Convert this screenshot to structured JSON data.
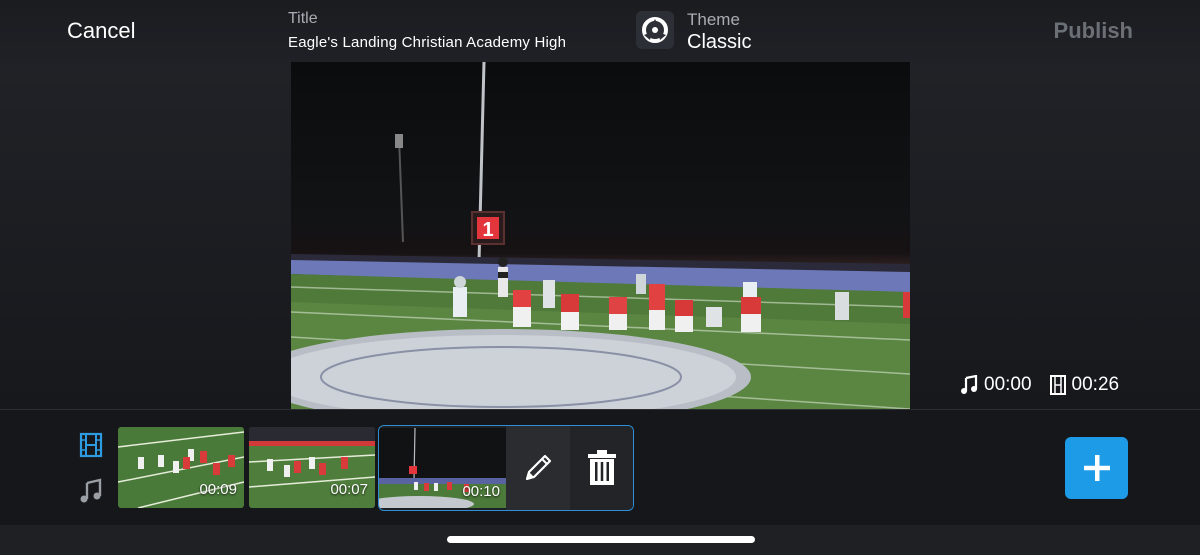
{
  "header": {
    "cancel_label": "Cancel",
    "title_label": "Title",
    "title_value": "Eagle's Landing Christian Academy High",
    "theme_label": "Theme",
    "theme_value": "Classic",
    "publish_label": "Publish"
  },
  "preview": {
    "scoreboard_digit": "1",
    "music_time": "00:00",
    "video_time": "00:26"
  },
  "timeline": {
    "tracks": [
      "film-icon",
      "music-note-icon"
    ],
    "clips": [
      {
        "duration": "00:09"
      },
      {
        "duration": "00:07"
      },
      {
        "duration": "00:10",
        "selected": true
      }
    ],
    "actions": [
      "pencil-icon",
      "trash-icon"
    ],
    "add_icon": "plus-icon"
  },
  "colors": {
    "accent": "#1e9be6",
    "selection_border": "#2e8fd6",
    "publish_disabled": "#6b6f76"
  }
}
